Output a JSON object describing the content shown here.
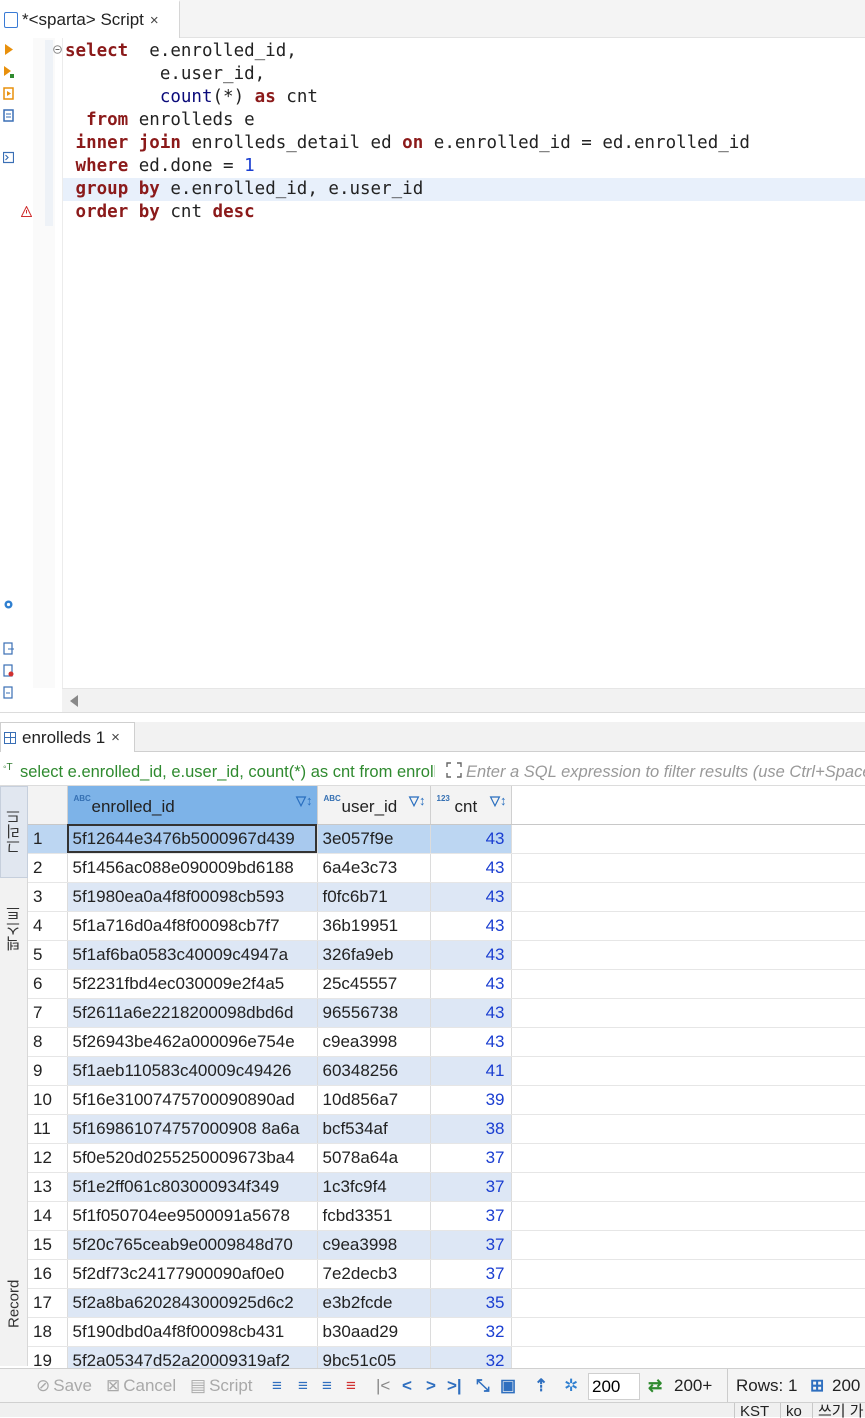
{
  "editor": {
    "tab_title": "*<sparta> Script",
    "close_glyph": "×",
    "sql_lines": [
      {
        "parts": [
          [
            "kw",
            "select"
          ],
          [
            "t",
            "  e.enrolled_id,"
          ]
        ]
      },
      {
        "parts": [
          [
            "t",
            "         e.user_id,"
          ]
        ]
      },
      {
        "parts": [
          [
            "t",
            "         "
          ],
          [
            "fn",
            "count"
          ],
          [
            "t",
            "(*) "
          ],
          [
            "kw",
            "as"
          ],
          [
            "t",
            " cnt"
          ]
        ]
      },
      {
        "parts": [
          [
            "t",
            "  "
          ],
          [
            "kw",
            "from"
          ],
          [
            "t",
            " enrolleds e"
          ]
        ]
      },
      {
        "parts": [
          [
            "t",
            " "
          ],
          [
            "kw",
            "inner join"
          ],
          [
            "t",
            " enrolleds_detail ed "
          ],
          [
            "kw",
            "on"
          ],
          [
            "t",
            " e.enrolled_id = ed.enrolled_id"
          ]
        ]
      },
      {
        "parts": [
          [
            "t",
            " "
          ],
          [
            "kw",
            "where"
          ],
          [
            "t",
            " ed.done = "
          ],
          [
            "num",
            "1"
          ]
        ]
      },
      {
        "parts": [
          [
            "t",
            " "
          ],
          [
            "kw",
            "group by"
          ],
          [
            "t",
            " e.enrolled_id, e.user_id"
          ]
        ]
      },
      {
        "parts": [
          [
            "t",
            " "
          ],
          [
            "kw",
            "order by"
          ],
          [
            "t",
            " cnt "
          ],
          [
            "kw",
            "desc"
          ]
        ]
      }
    ]
  },
  "results": {
    "tab_label": "enrolleds 1",
    "close_glyph": "×",
    "query_preview": "select e.enrolled_id, e.user_id, count(*) as cnt from enrolleds",
    "filter_placeholder": "Enter a SQL expression to filter results (use Ctrl+Space)",
    "side_tabs": {
      "grid": "그리드",
      "text": "텍스트",
      "record": "Record"
    },
    "columns": [
      {
        "label": "enrolled_id",
        "type_icon": "ABC"
      },
      {
        "label": "user_id",
        "type_icon": "ABC"
      },
      {
        "label": "cnt",
        "type_icon": "123"
      }
    ],
    "rows": [
      [
        "1",
        "5f12644e3476b5000967d439",
        "3e057f9e",
        "43"
      ],
      [
        "2",
        "5f1456ac088e090009bd6188",
        "6a4e3c73",
        "43"
      ],
      [
        "3",
        "5f1980ea0a4f8f00098cb593",
        "f0fc6b71",
        "43"
      ],
      [
        "4",
        "5f1a716d0a4f8f00098cb7f7",
        "36b19951",
        "43"
      ],
      [
        "5",
        "5f1af6ba0583c40009c4947a",
        "326fa9eb",
        "43"
      ],
      [
        "6",
        "5f2231fbd4ec030009e2f4a5",
        "25c45557",
        "43"
      ],
      [
        "7",
        "5f2611a6e2218200098dbd6d",
        "96556738",
        "43"
      ],
      [
        "8",
        "5f26943be462a000096e754e",
        "c9ea3998",
        "43"
      ],
      [
        "9",
        "5f1aeb110583c40009c49426",
        "60348256",
        "41"
      ],
      [
        "10",
        "5f16e31007475700090890ad",
        "10d856a7",
        "39"
      ],
      [
        "11",
        "5f169861074757000908 8a6a",
        "bcf534af",
        "38"
      ],
      [
        "12",
        "5f0e520d0255250009673ba4",
        "5078a64a",
        "37"
      ],
      [
        "13",
        "5f1e2ff061c803000934f349",
        "1c3fc9f4",
        "37"
      ],
      [
        "14",
        "5f1f050704ee9500091a5678",
        "fcbd3351",
        "37"
      ],
      [
        "15",
        "5f20c765ceab9e0009848d70",
        "c9ea3998",
        "37"
      ],
      [
        "16",
        "5f2df73c24177900090af0e0",
        "7e2decb3",
        "37"
      ],
      [
        "17",
        "5f2a8ba6202843000925d6c2",
        "e3b2fcde",
        "35"
      ],
      [
        "18",
        "5f190dbd0a4f8f00098cb431",
        "b30aad29",
        "32"
      ],
      [
        "19",
        "5f2a05347d52a20009319af2",
        "9bc51c05",
        "32"
      ]
    ]
  },
  "toolbar": {
    "save": "Save",
    "cancel": "Cancel",
    "script": "Script",
    "fetch_size": "200",
    "fetch_more": "200+",
    "rows": "Rows: 1",
    "selected": "200"
  },
  "statusbar": {
    "tz": "KST",
    "lang": "ko",
    "mode": "쓰기 가능"
  }
}
